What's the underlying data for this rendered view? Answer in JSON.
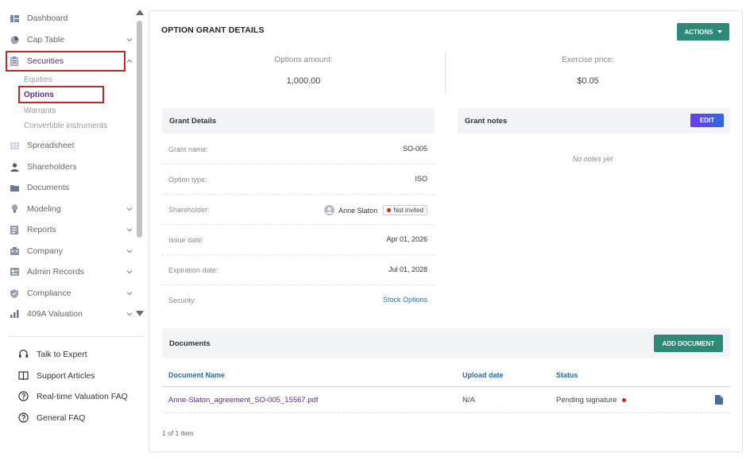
{
  "sidebar": {
    "items": [
      {
        "label": "Dashboard",
        "icon": "dashboard-icon",
        "expandable": false
      },
      {
        "label": "Cap Table",
        "icon": "pie-chart-icon",
        "expandable": true
      },
      {
        "label": "Securities",
        "icon": "clipboard-icon",
        "expandable": true,
        "expanded": true,
        "active": true
      },
      {
        "label": "Spreadsheet",
        "icon": "grid-icon",
        "expandable": false
      },
      {
        "label": "Shareholders",
        "icon": "person-icon",
        "expandable": false
      },
      {
        "label": "Documents",
        "icon": "folder-icon",
        "expandable": false
      },
      {
        "label": "Modeling",
        "icon": "lightbulb-icon",
        "expandable": true
      },
      {
        "label": "Reports",
        "icon": "report-icon",
        "expandable": true
      },
      {
        "label": "Company",
        "icon": "building-icon",
        "expandable": true
      },
      {
        "label": "Admin Records",
        "icon": "records-icon",
        "expandable": true
      },
      {
        "label": "Compliance",
        "icon": "shield-icon",
        "expandable": true
      },
      {
        "label": "409A Valuation",
        "icon": "bar-chart-icon",
        "expandable": true
      }
    ],
    "securities_sub": [
      {
        "label": "Equities",
        "active": false
      },
      {
        "label": "Options",
        "active": true
      },
      {
        "label": "Warrants",
        "active": false
      },
      {
        "label": "Convertible instruments",
        "active": false
      }
    ],
    "help": [
      {
        "label": "Talk to Expert",
        "icon": "headset-icon"
      },
      {
        "label": "Support Articles",
        "icon": "book-icon"
      },
      {
        "label": "Real-time Valuation FAQ",
        "icon": "question-circle-icon"
      },
      {
        "label": "General FAQ",
        "icon": "question-circle-icon"
      }
    ]
  },
  "main": {
    "title": "OPTION GRANT DETAILS",
    "actions_label": "ACTIONS",
    "summary": {
      "options_amount_label": "Options amount:",
      "options_amount_value": "1,000.00",
      "exercise_price_label": "Exercise price:",
      "exercise_price_value": "$0.05"
    },
    "grant_details": {
      "title": "Grant Details",
      "rows": [
        {
          "label": "Grant name:",
          "value": "SO-005"
        },
        {
          "label": "Option type:",
          "value": "ISO"
        },
        {
          "label": "Shareholder:",
          "value": "Anne Slaton",
          "badge": "Not invited"
        },
        {
          "label": "Issue date:",
          "value": "Apr 01, 2026"
        },
        {
          "label": "Expiration date:",
          "value": "Jul 01, 2028"
        },
        {
          "label": "Security:",
          "value": "Stock Options"
        }
      ]
    },
    "grant_notes": {
      "title": "Grant notes",
      "edit_label": "EDIT",
      "empty_text": "No notes yet"
    },
    "documents": {
      "title": "Documents",
      "add_label": "ADD DOCUMENT",
      "columns": [
        "Document Name",
        "Upload date",
        "Status"
      ],
      "rows": [
        {
          "name": "Anne-Slaton_agreement_SO-005_15567.pdf",
          "upload_date": "N/A",
          "status": "Pending signature"
        }
      ],
      "pager": "1 of 1 item"
    }
  },
  "colors": {
    "accent_green": "#2e8a78",
    "active_purple": "#5b2a86",
    "highlight_red": "#c0272d",
    "status_red": "#c62828"
  }
}
